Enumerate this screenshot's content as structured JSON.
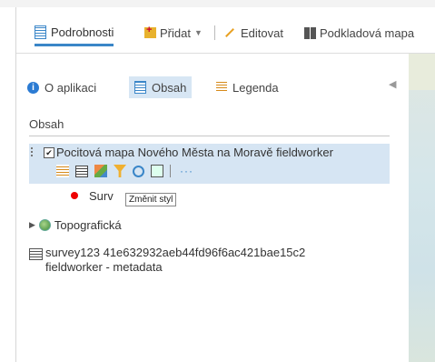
{
  "toolbar": {
    "details_label": "Podrobnosti",
    "add_label": "Přidat",
    "edit_label": "Editovat",
    "basemap_label": "Podkladová mapa"
  },
  "tabs": {
    "about": "O aplikaci",
    "content": "Obsah",
    "legend": "Legenda"
  },
  "section_title": "Obsah",
  "layer": {
    "name": "Pocitová mapa Nového Města na Moravě fieldworker",
    "checked": true,
    "more_label": "···"
  },
  "sublayer": {
    "name": "Survey Points",
    "visible_text": "Surv"
  },
  "tooltip": "Změnit styl",
  "topo_label": "Topografická",
  "table": {
    "line1": "survey123 41e632932aeb44fd96f6ac421bae15c2",
    "line2": "fieldworker - metadata"
  },
  "colors": {
    "accent": "#3a86c8",
    "selected_bg": "#d6e5f3",
    "point": "#e00000"
  }
}
